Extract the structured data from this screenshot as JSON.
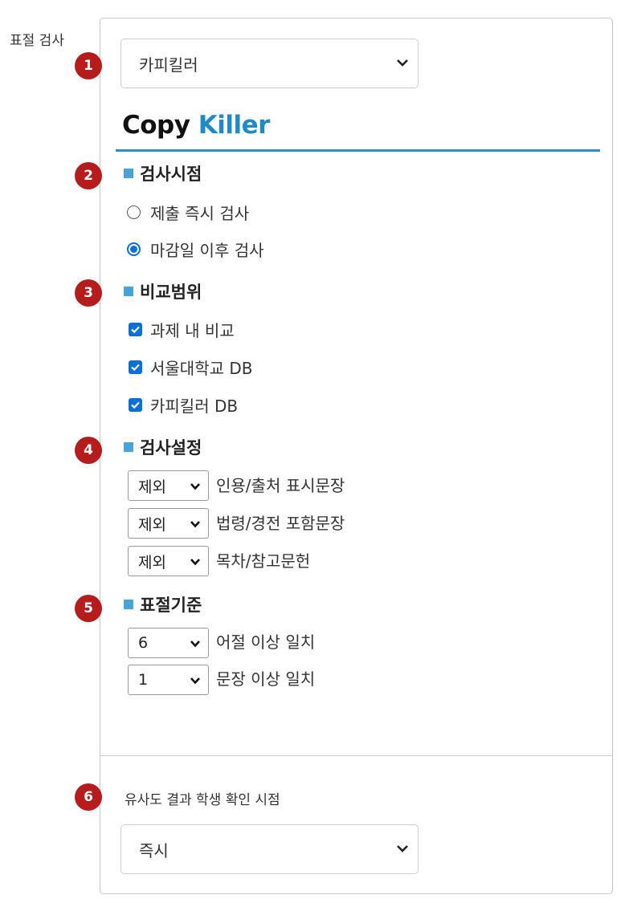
{
  "page_label": "표절 검사",
  "markers": [
    "1",
    "2",
    "3",
    "4",
    "5",
    "6"
  ],
  "tool_select": {
    "value": "카피킬러"
  },
  "logo": {
    "part1": "Copy",
    "part2": "Killer"
  },
  "colors": {
    "marker": "#b71c1c",
    "accent": "#2a8fc2",
    "section_square": "#4aa3d6",
    "control_blue": "#0a6fd8"
  },
  "check_time": {
    "title": "검사시점",
    "options": [
      {
        "label": "제출 즉시 검사",
        "selected": false
      },
      {
        "label": "마감일 이후 검사",
        "selected": true
      }
    ]
  },
  "compare_scope": {
    "title": "비교범위",
    "options": [
      {
        "label": "과제 내 비교",
        "checked": true
      },
      {
        "label": "서울대학교 DB",
        "checked": true
      },
      {
        "label": "카피킬러 DB",
        "checked": true
      }
    ]
  },
  "check_settings": {
    "title": "검사설정",
    "rows": [
      {
        "value": "제외",
        "label": "인용/출처 표시문장"
      },
      {
        "value": "제외",
        "label": "법령/경전 포함문장"
      },
      {
        "value": "제외",
        "label": "목차/참고문헌"
      }
    ]
  },
  "plagiarism_criteria": {
    "title": "표절기준",
    "rows": [
      {
        "value": "6",
        "label": "어절 이상 일치"
      },
      {
        "value": "1",
        "label": "문장 이상 일치"
      }
    ]
  },
  "student_view": {
    "label": "유사도 결과 학생 확인 시점",
    "value": "즉시"
  }
}
